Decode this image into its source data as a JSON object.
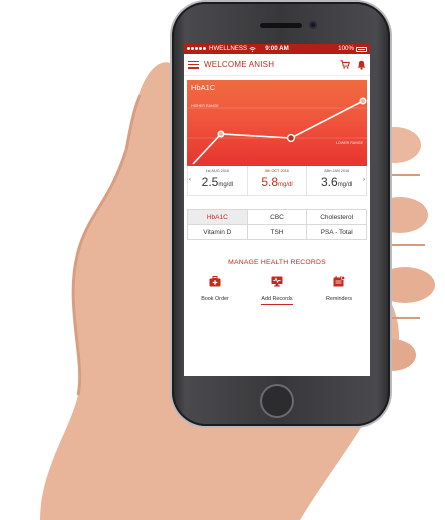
{
  "status_bar": {
    "carrier": "HWELLNESS",
    "time": "9:00 AM",
    "battery": "100%"
  },
  "app_bar": {
    "title": "WELCOME ANISH",
    "icons": [
      "menu-icon",
      "cart-icon",
      "bell-icon"
    ]
  },
  "chart_data": {
    "type": "line",
    "title": "HbA1C",
    "band_labels": [
      "HIGHER RANGE",
      "LOWER RANGE"
    ],
    "x": [
      "1st AUG 2016",
      "5th OCT 2016",
      "28th JAN 2016"
    ],
    "series": [
      {
        "values": [
          2.5,
          5.8,
          3.6
        ]
      }
    ]
  },
  "readings": [
    {
      "date": "1st AUG 2016",
      "value": "2.5",
      "unit": "mg/dl",
      "active": false
    },
    {
      "date": "5th OCT 2016",
      "value": "5.8",
      "unit": "mg/dl",
      "active": true
    },
    {
      "date": "28th JAN 2016",
      "value": "3.6",
      "unit": "mg/dl",
      "active": false
    }
  ],
  "tests": [
    "HbA1C",
    "CBC",
    "Cholesterol",
    "Vitamin D",
    "TSH",
    "PSA - Total"
  ],
  "active_test": "HbA1C",
  "health_records": {
    "title": "MANAGE HEALTH RECORDS",
    "actions": [
      {
        "label": "Book Order",
        "icon": "medical-kit-icon"
      },
      {
        "label": "Add Records",
        "icon": "records-monitor-icon"
      },
      {
        "label": "Reminders",
        "icon": "calendar-reminder-icon"
      }
    ]
  },
  "colors": {
    "brand_red": "#c42a1d",
    "chart_orange": "#ef6b3f",
    "chart_red": "#e7342f"
  }
}
